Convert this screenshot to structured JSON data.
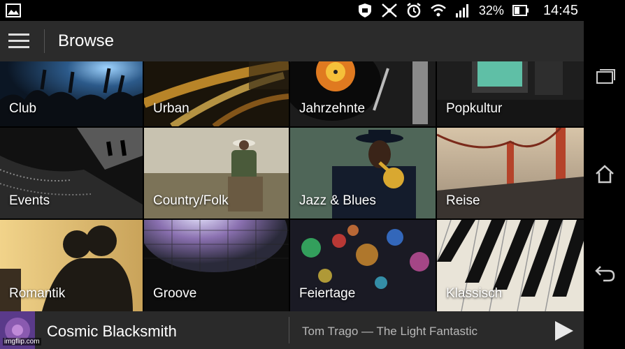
{
  "status_bar": {
    "battery_percent": "32%",
    "time": "14:45",
    "icons": [
      "gallery-icon",
      "shield-icon",
      "nfc-icon",
      "alarm-icon",
      "wifi-icon",
      "signal-icon",
      "battery-icon"
    ]
  },
  "app_bar": {
    "title": "Browse",
    "menu_icon": "hamburger-menu-icon"
  },
  "categories": [
    {
      "label": "Club"
    },
    {
      "label": "Urban"
    },
    {
      "label": "Jahrzehnte"
    },
    {
      "label": "Popkultur"
    },
    {
      "label": "Events"
    },
    {
      "label": "Country/Folk"
    },
    {
      "label": "Jazz & Blues"
    },
    {
      "label": "Reise"
    },
    {
      "label": "Romantik"
    },
    {
      "label": "Groove"
    },
    {
      "label": "Feiertage"
    },
    {
      "label": "Klassisch"
    }
  ],
  "player": {
    "title": "Cosmic Blacksmith",
    "subtitle": "Tom Trago — The Light Fantastic",
    "play_icon": "play-icon"
  },
  "nav_bar": {
    "icons": [
      "recent-apps-icon",
      "home-icon",
      "back-icon"
    ]
  },
  "watermark": "imgflip.com"
}
